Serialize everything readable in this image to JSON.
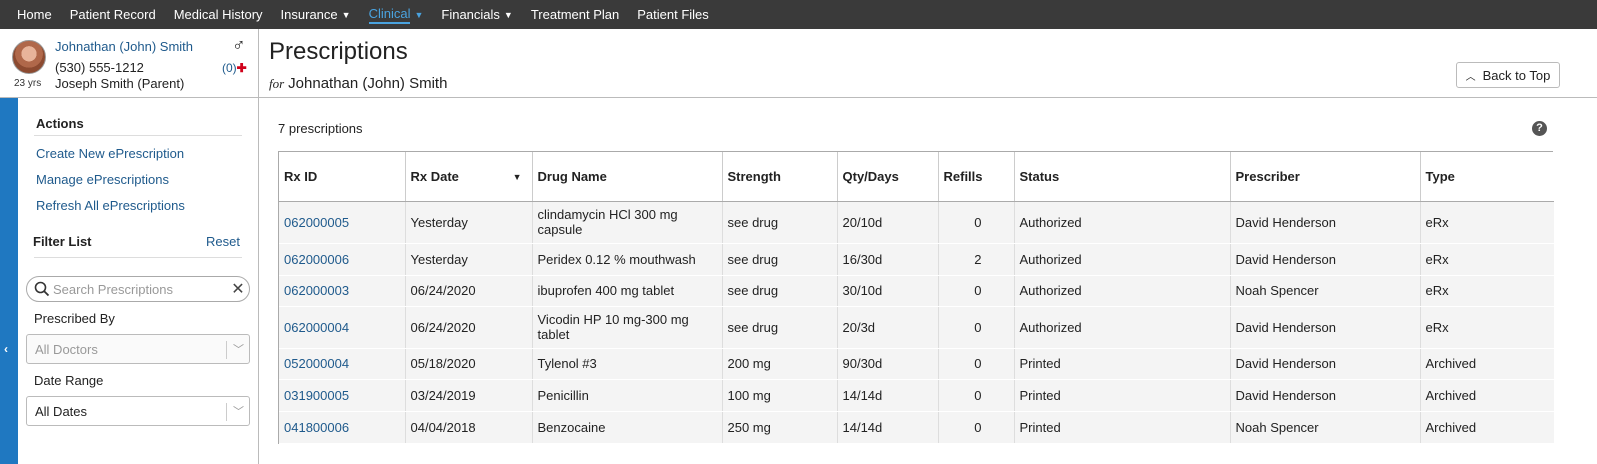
{
  "nav": {
    "items": [
      {
        "label": "Home",
        "dropdown": false,
        "active": false
      },
      {
        "label": "Patient Record",
        "dropdown": false,
        "active": false
      },
      {
        "label": "Medical History",
        "dropdown": false,
        "active": false
      },
      {
        "label": "Insurance",
        "dropdown": true,
        "active": false
      },
      {
        "label": "Clinical",
        "dropdown": true,
        "active": true
      },
      {
        "label": "Financials",
        "dropdown": true,
        "active": false
      },
      {
        "label": "Treatment Plan",
        "dropdown": false,
        "active": false
      },
      {
        "label": "Patient Files",
        "dropdown": false,
        "active": false
      }
    ]
  },
  "patient": {
    "name": "Johnathan (John) Smith",
    "phone": "(530) 555-1212",
    "guardian": "Joseph Smith (Parent)",
    "age": "23 yrs",
    "gender_symbol": "♂",
    "alert_count": "(0)",
    "alert_symbol": "✚"
  },
  "header": {
    "title": "Prescriptions",
    "for_prefix": "for",
    "for_name": "Johnathan (John) Smith",
    "back_to_top": "Back to Top"
  },
  "sidebar": {
    "actions_title": "Actions",
    "actions": [
      "Create New ePrescription",
      "Manage ePrescriptions",
      "Refresh All ePrescriptions"
    ],
    "filter_title": "Filter List",
    "reset": "Reset",
    "search_placeholder": "Search Prescriptions",
    "prescribed_by_label": "Prescribed By",
    "prescribed_by_value": "All Doctors",
    "date_range_label": "Date Range",
    "date_range_value": "All Dates"
  },
  "content": {
    "count": "7 prescriptions",
    "help": "?",
    "columns": [
      "Rx ID",
      "Rx Date",
      "Drug Name",
      "Strength",
      "Qty/Days",
      "Refills",
      "Status",
      "Prescriber",
      "Type"
    ],
    "rows": [
      {
        "rx_id": "062000005",
        "date": "Yesterday",
        "drug": "clindamycin HCl 300 mg capsule",
        "strength": "see drug",
        "qty": "20/10d",
        "refills": "0",
        "status": "Authorized",
        "prescriber": "David Henderson",
        "type": "eRx"
      },
      {
        "rx_id": "062000006",
        "date": "Yesterday",
        "drug": "Peridex 0.12 % mouthwash",
        "strength": "see drug",
        "qty": "16/30d",
        "refills": "2",
        "status": "Authorized",
        "prescriber": "David Henderson",
        "type": "eRx"
      },
      {
        "rx_id": "062000003",
        "date": "06/24/2020",
        "drug": "ibuprofen 400 mg tablet",
        "strength": "see drug",
        "qty": "30/10d",
        "refills": "0",
        "status": "Authorized",
        "prescriber": "Noah Spencer",
        "type": "eRx"
      },
      {
        "rx_id": "062000004",
        "date": "06/24/2020",
        "drug": "Vicodin HP 10 mg-300 mg tablet",
        "strength": "see drug",
        "qty": "20/3d",
        "refills": "0",
        "status": "Authorized",
        "prescriber": "David Henderson",
        "type": "eRx"
      },
      {
        "rx_id": "052000004",
        "date": "05/18/2020",
        "drug": "Tylenol #3",
        "strength": "200 mg",
        "qty": "90/30d",
        "refills": "0",
        "status": "Printed",
        "prescriber": "David Henderson",
        "type": "Archived"
      },
      {
        "rx_id": "031900005",
        "date": "03/24/2019",
        "drug": "Penicillin",
        "strength": "100 mg",
        "qty": "14/14d",
        "refills": "0",
        "status": "Printed",
        "prescriber": "David Henderson",
        "type": "Archived"
      },
      {
        "rx_id": "041800006",
        "date": "04/04/2018",
        "drug": "Benzocaine",
        "strength": "250 mg",
        "qty": "14/14d",
        "refills": "0",
        "status": "Printed",
        "prescriber": "Noah Spencer",
        "type": "Archived"
      }
    ]
  }
}
